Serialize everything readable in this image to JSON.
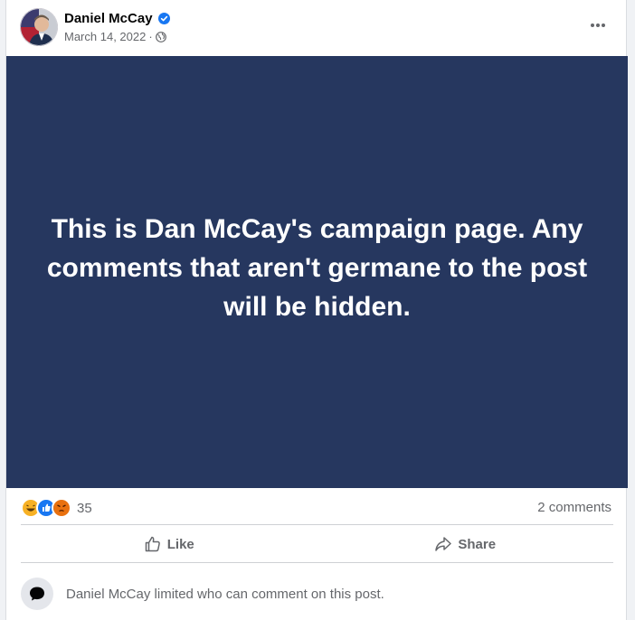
{
  "post": {
    "author": "Daniel McCay",
    "date": "March 14, 2022",
    "date_separator": "·",
    "image_text": "This is Dan McCay's campaign page. Any comments that aren't germane to the post will be hidden."
  },
  "icons": {
    "avatar": "profile-photo",
    "verified": "verified-badge-icon",
    "privacy": "globe-icon",
    "more": "more-options-icon",
    "like": "thumbs-up-icon",
    "share": "share-arrow-icon",
    "limit": "speech-bubble-icon"
  },
  "stats": {
    "reactions": [
      "haha",
      "like",
      "angry"
    ],
    "reaction_count": "35",
    "comments_label": "2 comments"
  },
  "actions": {
    "like_label": "Like",
    "share_label": "Share"
  },
  "notice": {
    "text": "Daniel McCay limited who can comment on this post."
  },
  "colors": {
    "image_background": "#26375f",
    "verified_blue": "#1877f2",
    "secondary_text": "#65676b"
  }
}
